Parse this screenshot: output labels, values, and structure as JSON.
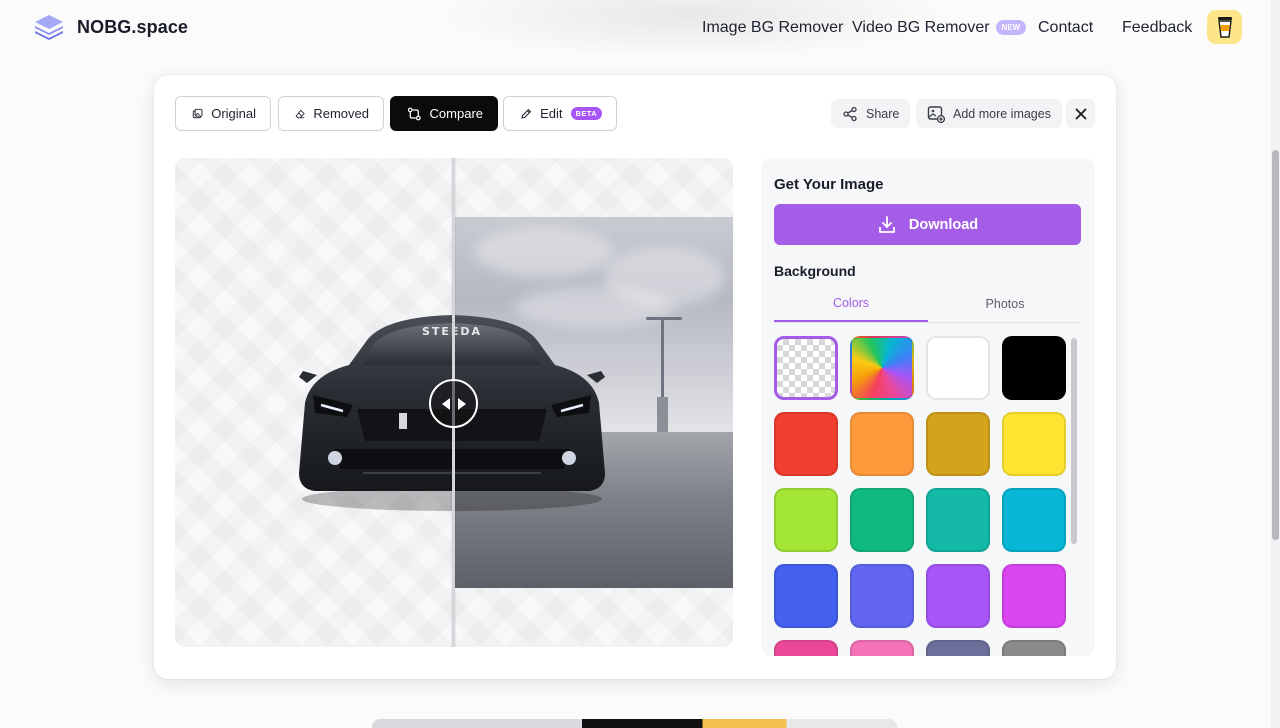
{
  "brand": {
    "name": "NOBG.space"
  },
  "nav": {
    "items": [
      {
        "label": "Image BG Remover"
      },
      {
        "label": "Video BG Remover",
        "badge": "NEW"
      },
      {
        "label": "Contact"
      },
      {
        "label": "Feedback"
      }
    ],
    "coffee_icon": "coffee-cup-icon"
  },
  "toolbar": {
    "tabs": [
      {
        "label": "Original",
        "icon": "image-icon",
        "active": false
      },
      {
        "label": "Removed",
        "icon": "eraser-icon",
        "active": false
      },
      {
        "label": "Compare",
        "icon": "compare-icon",
        "active": true
      },
      {
        "label": "Edit",
        "icon": "pencil-icon",
        "badge": "BETA",
        "active": false
      }
    ],
    "share_label": "Share",
    "add_more_label": "Add more images"
  },
  "panel": {
    "title": "Get Your Image",
    "download_label": "Download",
    "background_title": "Background",
    "subtabs": [
      {
        "label": "Colors",
        "active": true
      },
      {
        "label": "Photos",
        "active": false
      }
    ],
    "swatches": [
      {
        "name": "transparent",
        "color": "transparent",
        "selected": true
      },
      {
        "name": "gradient",
        "color": "conic"
      },
      {
        "name": "white",
        "color": "#ffffff"
      },
      {
        "name": "black",
        "color": "#000000"
      },
      {
        "name": "red",
        "color": "#f03e2f"
      },
      {
        "name": "orange",
        "color": "#ff9a3c"
      },
      {
        "name": "goldenrod",
        "color": "#d4a21c"
      },
      {
        "name": "yellow",
        "color": "#ffe531"
      },
      {
        "name": "lime",
        "color": "#a3e635"
      },
      {
        "name": "green",
        "color": "#10b981"
      },
      {
        "name": "teal",
        "color": "#14b8a6"
      },
      {
        "name": "cyan",
        "color": "#06b6d4"
      },
      {
        "name": "blue",
        "color": "#4361ee"
      },
      {
        "name": "indigo",
        "color": "#6366f1"
      },
      {
        "name": "purple",
        "color": "#a855f7"
      },
      {
        "name": "magenta",
        "color": "#d946ef"
      }
    ]
  },
  "colors": {
    "accent": "#a35de6",
    "active_tab": "#0b0b0e"
  }
}
